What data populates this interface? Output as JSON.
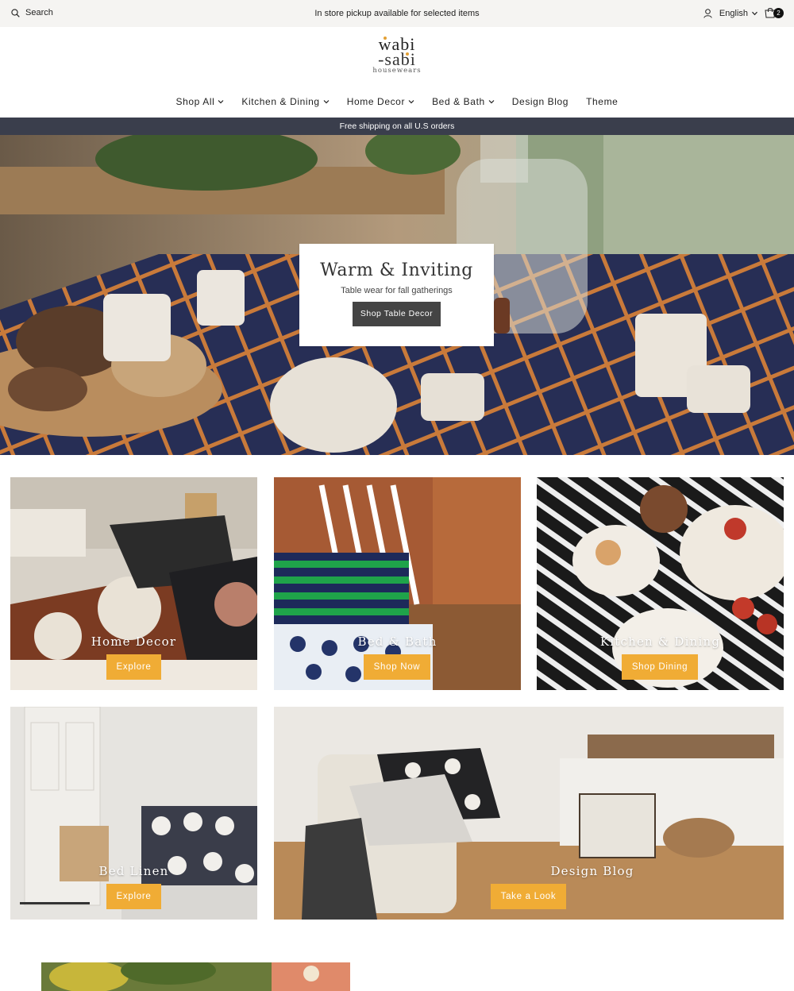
{
  "topbar": {
    "search_label": "Search",
    "promo": "In store pickup available for selected items",
    "language": "English",
    "cart_count": "2"
  },
  "logo": {
    "line1": "wabi",
    "line2": "-sabi",
    "line3": "housewears"
  },
  "nav": {
    "items": [
      {
        "label": "Shop All",
        "dropdown": true
      },
      {
        "label": "Kitchen & Dining",
        "dropdown": true
      },
      {
        "label": "Home Decor",
        "dropdown": true
      },
      {
        "label": "Bed & Bath",
        "dropdown": true
      },
      {
        "label": "Design Blog",
        "dropdown": false
      },
      {
        "label": "Theme",
        "dropdown": false
      }
    ]
  },
  "shipping_bar": "Free shipping on all U.S orders",
  "hero": {
    "title": "Warm & Inviting",
    "subtitle": "Table wear for fall gatherings",
    "button": "Shop Table Decor"
  },
  "tiles": [
    {
      "label": "Home Decor",
      "button": "Explore"
    },
    {
      "label": "Bed & Bath",
      "button": "Shop Now"
    },
    {
      "label": "Kitchen & Dining",
      "button": "Shop Dining"
    },
    {
      "label": "Bed Linen",
      "button": "Explore"
    },
    {
      "label": "Design Blog",
      "button": "Take a Look"
    }
  ],
  "colors": {
    "topbar_bg": "#f5f4f2",
    "shipbar_bg": "#3a3e4c",
    "accent_button": "#f0ac35",
    "hero_button": "#444444"
  },
  "icons": {
    "search": "search-icon",
    "user": "user-icon",
    "cart": "cart-icon",
    "chevron": "chevron-down-icon"
  }
}
